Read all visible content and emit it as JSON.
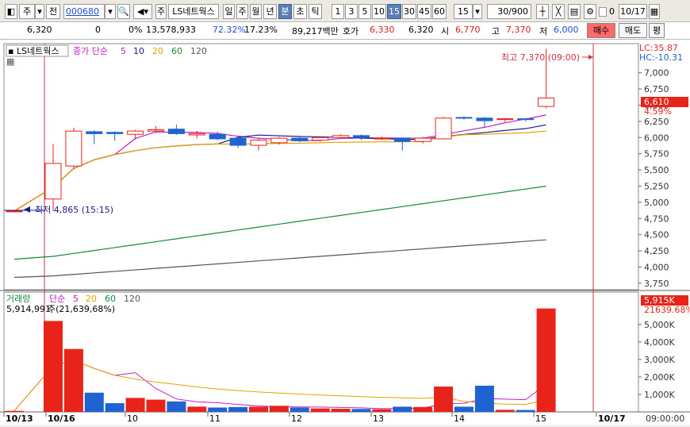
{
  "toolbar": {
    "mode": "주",
    "prefix": "전",
    "code": "000680",
    "name": "LS네트웍스",
    "periods": [
      "일",
      "주",
      "월",
      "년",
      "분",
      "초",
      "틱"
    ],
    "active_period": "분",
    "minutes": [
      "1",
      "3",
      "5",
      "10",
      "15",
      "30",
      "45",
      "60"
    ],
    "active_minute": "15",
    "interval_value": "15",
    "count": "30/900",
    "date": "10/17",
    "checkbox_value": "0"
  },
  "quote": {
    "price": "6,320",
    "change": "0",
    "change_pct": "0%",
    "volume": "13,578,933",
    "ratio1": "72.32%",
    "ratio2": "17.23%",
    "amount": "89,217백만",
    "ask_label": "호가",
    "ask": "6,330",
    "bid": "6,320",
    "open_label": "시",
    "open": "6,770",
    "high_label": "고",
    "high": "7,370",
    "low_label": "저",
    "low": "6,000",
    "buy_label": "매수",
    "sell_label": "매도",
    "eval_label": "평"
  },
  "price_legend": {
    "name": "LS네트웍스",
    "type": "종가 단순",
    "ma": [
      "5",
      "10",
      "20",
      "60",
      "120"
    ]
  },
  "volume_legend": {
    "name": "거래량",
    "type": "단순",
    "ma": [
      "5",
      "20",
      "60",
      "120"
    ],
    "value": "5,914,991",
    "unit_note": "주(21,639,68%)"
  },
  "annotations": {
    "high": "최고 7,370 (09:00)",
    "low": "최저 4,865 (15:15)",
    "lc": "LC:35.87",
    "hc": "HC:-10.31",
    "price_tag": "6,610",
    "pct_tag": "4.59%",
    "vol_tag": "5,915K",
    "vol_pct_tag": "21639.68%"
  },
  "colors": {
    "up": "#e8231a",
    "down": "#1f63d0",
    "ma5": "#c21ec8",
    "ma10": "#1a1a8c",
    "ma20": "#e8a000",
    "ma60": "#17883a",
    "ma120": "#555555",
    "high_line": "#d03040"
  },
  "chart_data": {
    "type": "candlestick",
    "price_axis": [
      "7,000",
      "6,750",
      "6,500",
      "6,250",
      "6,000",
      "5,750",
      "5,500",
      "5,250",
      "5,000",
      "4,750",
      "4,500",
      "4,250",
      "4,000",
      "3,750"
    ],
    "volume_axis": [
      "5,000K",
      "4,000K",
      "3,000K",
      "2,000K",
      "1,000K"
    ],
    "date_labels": [
      "10/13",
      "10/16",
      "10",
      "11",
      "12",
      "13",
      "14",
      "15",
      "10/17"
    ],
    "time_label": "09:00:00",
    "candles": [
      {
        "o": 4865,
        "c": 4865,
        "h": 4865,
        "l": 4865,
        "v": 60
      },
      {
        "o": 5050,
        "c": 5600,
        "h": 5900,
        "l": 4865,
        "v": 5200
      },
      {
        "o": 5560,
        "c": 6100,
        "h": 6150,
        "l": 5520,
        "v": 3600
      },
      {
        "o": 6090,
        "c": 6060,
        "h": 6110,
        "l": 5900,
        "v": 1100
      },
      {
        "o": 6080,
        "c": 6060,
        "h": 6100,
        "l": 5950,
        "v": 500
      },
      {
        "o": 6050,
        "c": 6100,
        "h": 6120,
        "l": 5970,
        "v": 800
      },
      {
        "o": 6100,
        "c": 6120,
        "h": 6180,
        "l": 6070,
        "v": 700
      },
      {
        "o": 6130,
        "c": 6060,
        "h": 6200,
        "l": 6040,
        "v": 600
      },
      {
        "o": 6040,
        "c": 6060,
        "h": 6100,
        "l": 5990,
        "v": 300
      },
      {
        "o": 6050,
        "c": 5980,
        "h": 6090,
        "l": 5960,
        "v": 250
      },
      {
        "o": 5990,
        "c": 5880,
        "h": 6020,
        "l": 5840,
        "v": 280
      },
      {
        "o": 5880,
        "c": 5960,
        "h": 5990,
        "l": 5800,
        "v": 300
      },
      {
        "o": 5920,
        "c": 5990,
        "h": 6010,
        "l": 5890,
        "v": 350
      },
      {
        "o": 5990,
        "c": 5950,
        "h": 6020,
        "l": 5930,
        "v": 250
      },
      {
        "o": 5960,
        "c": 6000,
        "h": 6020,
        "l": 5940,
        "v": 200
      },
      {
        "o": 6000,
        "c": 6030,
        "h": 6050,
        "l": 5980,
        "v": 180
      },
      {
        "o": 6030,
        "c": 6000,
        "h": 6050,
        "l": 5960,
        "v": 170
      },
      {
        "o": 5980,
        "c": 5990,
        "h": 6010,
        "l": 5960,
        "v": 150
      },
      {
        "o": 5990,
        "c": 5940,
        "h": 6000,
        "l": 5800,
        "v": 300
      },
      {
        "o": 5940,
        "c": 5990,
        "h": 6010,
        "l": 5910,
        "v": 280
      },
      {
        "o": 5980,
        "c": 6300,
        "h": 6320,
        "l": 5970,
        "v": 1450
      },
      {
        "o": 6310,
        "c": 6300,
        "h": 6330,
        "l": 6280,
        "v": 300
      },
      {
        "o": 6300,
        "c": 6260,
        "h": 6320,
        "l": 6150,
        "v": 1500
      },
      {
        "o": 6280,
        "c": 6290,
        "h": 6300,
        "l": 6240,
        "v": 120
      },
      {
        "o": 6290,
        "c": 6280,
        "h": 6300,
        "l": 6250,
        "v": 110
      },
      {
        "o": 6480,
        "c": 6610,
        "h": 7370,
        "l": 6450,
        "v": 5915
      }
    ]
  }
}
